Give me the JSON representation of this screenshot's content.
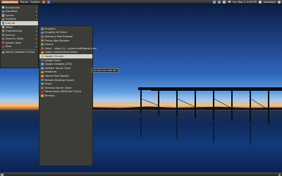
{
  "top_panel": {
    "menus": [
      "Applications",
      "Places",
      "System"
    ],
    "clock": "Sun May 2, 5:08 PM",
    "user": "jamesbaik"
  },
  "categories": [
    {
      "label": "Accessories",
      "icon": "accessories-icon",
      "color": "#c9c9c9"
    },
    {
      "label": "Education",
      "icon": "education-icon",
      "color": "#6b8fd0"
    },
    {
      "label": "Games",
      "icon": "games-icon",
      "color": "#b0b0b0"
    },
    {
      "label": "Graphics",
      "icon": "graphics-icon",
      "color": "#d07a3c"
    },
    {
      "label": "Internet",
      "icon": "internet-icon",
      "color": "#3f7fd0",
      "selected": true
    },
    {
      "label": "Office",
      "icon": "office-icon",
      "color": "#d8c26a"
    },
    {
      "label": "Programming",
      "icon": "programming-icon",
      "color": "#8a8a8a"
    },
    {
      "label": "Science",
      "icon": "science-icon",
      "color": "#5fa35f"
    },
    {
      "label": "Sound & Video",
      "icon": "sound-video-icon",
      "color": "#b55555"
    },
    {
      "label": "System Tools",
      "icon": "system-tools-icon",
      "color": "#7a7a7a"
    },
    {
      "label": "Wine",
      "icon": "wine-icon",
      "color": "#a04040"
    },
    {
      "label": "Ubuntu Software Center",
      "icon": "software-center-icon",
      "color": "#d98a3a"
    }
  ],
  "internet_items": [
    {
      "label": "Empathy",
      "icon": "empathy-icon",
      "color": "#5a8fd8"
    },
    {
      "label": "Empathy IM Client",
      "icon": "empathy-im-icon",
      "color": "#5a8fd8"
    },
    {
      "label": "Epiphany Web Browser",
      "icon": "epiphany-icon",
      "color": "#4a7ac0"
    },
    {
      "label": "Firefox Web Browser",
      "icon": "firefox-icon",
      "color": "#e07a2a"
    },
    {
      "label": "Freeciv",
      "icon": "freeciv-icon",
      "color": "#7aa04a"
    },
    {
      "label": "Gmail - Inbox (1) - sylvermind@gmail.com",
      "icon": "gmail-icon",
      "color": "#d04a3a"
    },
    {
      "label": "Gobby Collaborative Editor",
      "icon": "gobby-icon",
      "color": "#c9a83a"
    },
    {
      "label": "Google Chrome",
      "icon": "chrome-icon",
      "color": "#d8b53a",
      "hovered": true
    },
    {
      "label": "Google Earth",
      "icon": "google-earth-icon",
      "color": "#3a7ad0"
    },
    {
      "label": "Google Gadgets (GTK)",
      "icon": "google-gadgets-icon",
      "color": "#6aa0d8"
    },
    {
      "label": "Gwibber Social Client",
      "icon": "gwibber-icon",
      "color": "#5a9ad0"
    },
    {
      "label": "Headlines",
      "icon": "headlines-icon",
      "color": "#d89a3a"
    },
    {
      "label": "Liferea Feed Reader",
      "icon": "liferea-icon",
      "color": "#e08a2a"
    },
    {
      "label": "Remote Desktop Viewer",
      "icon": "remote-desktop-icon",
      "color": "#6a8ab0"
    },
    {
      "label": "Skype",
      "icon": "skype-icon",
      "color": "#3aa0e0"
    },
    {
      "label": "Terminal Server Client",
      "icon": "terminal-server-icon",
      "color": "#7a7a7a"
    },
    {
      "label": "Transmission BitTorrent Client",
      "icon": "transmission-icon",
      "color": "#b03a3a"
    },
    {
      "label": "Winamp",
      "icon": "winamp-icon",
      "color": "#e0a030"
    }
  ],
  "tooltip": "Access the Internet"
}
